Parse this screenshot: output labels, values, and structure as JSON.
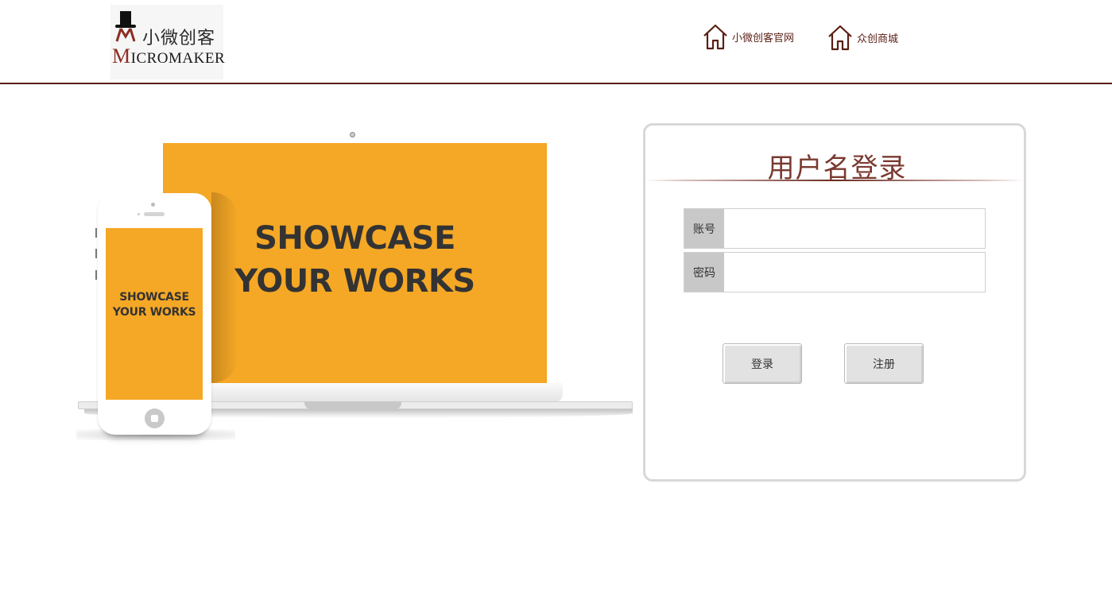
{
  "header": {
    "logo": {
      "cn_text": "小微创客",
      "en_text": "MICROMAKER"
    },
    "nav": [
      {
        "label": "小微创客官网",
        "icon": "house-icon"
      },
      {
        "label": "众创商城",
        "icon": "house-icon"
      }
    ]
  },
  "hero": {
    "laptop_text_line1": "SHOWCASE",
    "laptop_text_line2": "YOUR WORKS",
    "phone_text_line1": "SHOWCASE",
    "phone_text_line2": "YOUR WORKS",
    "screen_color": "#f5a825"
  },
  "login": {
    "title": "用户名登录",
    "username_label": "账号",
    "username_value": "",
    "password_label": "密码",
    "password_value": "",
    "login_button": "登录",
    "register_button": "注册"
  },
  "colors": {
    "brand": "#5a1e14",
    "title": "#7a3a30",
    "accent": "#f5a825"
  }
}
